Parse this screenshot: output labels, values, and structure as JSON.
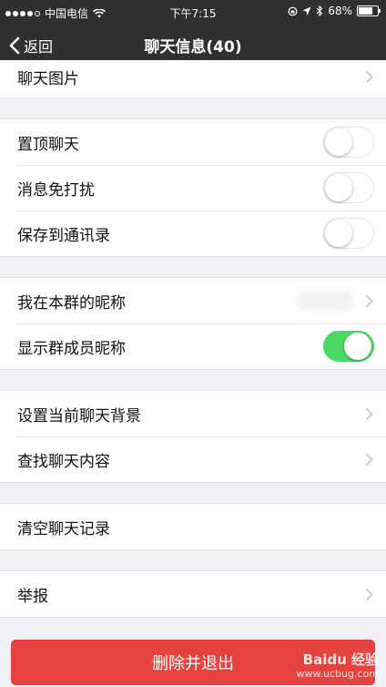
{
  "status_bar": {
    "carrier": "中国电信",
    "time": "下午7:15",
    "battery": "68%"
  },
  "nav": {
    "back_label": "返回",
    "title": "聊天信息(40)"
  },
  "groups": [
    {
      "rows": [
        {
          "label": "聊天图片",
          "control": "chevron"
        }
      ]
    },
    {
      "rows": [
        {
          "label": "置顶聊天",
          "control": "toggle",
          "on": false
        },
        {
          "label": "消息免打扰",
          "control": "toggle",
          "on": false
        },
        {
          "label": "保存到通讯录",
          "control": "toggle",
          "on": false
        }
      ]
    },
    {
      "rows": [
        {
          "label": "我在本群的昵称",
          "control": "chevron"
        },
        {
          "label": "显示群成员昵称",
          "control": "toggle",
          "on": true
        }
      ]
    },
    {
      "rows": [
        {
          "label": "设置当前聊天背景",
          "control": "chevron"
        },
        {
          "label": "查找聊天内容",
          "control": "chevron"
        }
      ]
    },
    {
      "rows": [
        {
          "label": "清空聊天记录",
          "control": "none"
        }
      ]
    },
    {
      "rows": [
        {
          "label": "举报",
          "control": "chevron"
        }
      ]
    }
  ],
  "delete_button": {
    "label": "删除并退出"
  },
  "watermark": {
    "brand": "Baidu 经验",
    "url": "www.ucbug.com"
  },
  "colors": {
    "toggle_on": "#4cd964",
    "danger": "#e64340",
    "nav_bg": "#2f3032"
  }
}
